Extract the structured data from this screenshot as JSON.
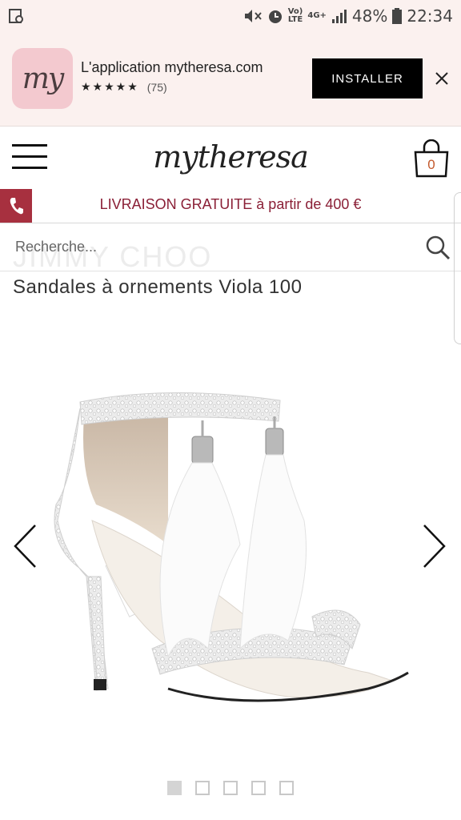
{
  "status_bar": {
    "battery": "48%",
    "time": "22:34",
    "network_top": "Vo)",
    "network_bottom": "LTE",
    "signal_label": "4G+"
  },
  "app_banner": {
    "icon_text": "my",
    "title": "L'application mytheresa.com",
    "stars": "★★★★★",
    "rating_count": "(75)",
    "install_label": "INSTALLER"
  },
  "header": {
    "logo": "mytheresa",
    "bag_count": "0"
  },
  "shipping": {
    "text": "LIVRAISON GRATUITE à partir de 400 €"
  },
  "search": {
    "placeholder": "Recherche..."
  },
  "product": {
    "brand": "JIMMY CHOO",
    "title": "Sandales à ornements Viola 100",
    "image_count": 5,
    "active_image": 1
  },
  "colors": {
    "banner_bg": "#fbf1ef",
    "install_bg": "#000000",
    "shipping_text": "#8a1f36",
    "phone_box": "#a7303f",
    "bag_count": "#c3582b"
  }
}
